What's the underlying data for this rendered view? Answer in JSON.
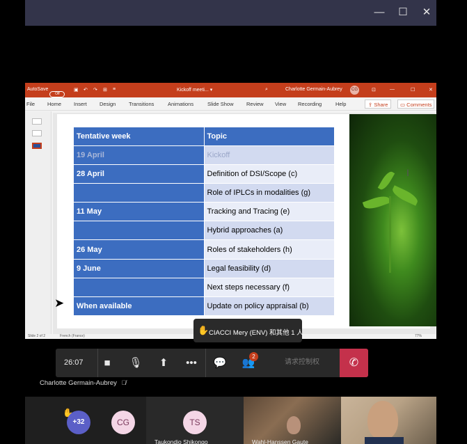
{
  "window_controls": {
    "minimize": "—",
    "maximize": "☐",
    "close": "✕"
  },
  "ppt": {
    "autosave_label": "AutoSave",
    "autosave_state": "Off",
    "doc_title": "Kickoff meeti... ▾",
    "user_name": "Charlotte Germain-Aubrey",
    "user_initials": "CG",
    "menu": [
      "File",
      "Home",
      "Insert",
      "Design",
      "Transitions",
      "Animations",
      "Slide Show",
      "Review",
      "View",
      "Recording",
      "Help"
    ],
    "share_label": "Share",
    "comments_label": "Comments",
    "status_left": "Slide 2 of 2",
    "status_lang": "French (France)",
    "status_zoom": "77%"
  },
  "table": {
    "headers": [
      "Tentative week",
      "Topic"
    ],
    "rows": [
      {
        "week": "19 April",
        "topic": "Kickoff"
      },
      {
        "week": "28 April",
        "topic": "Definition of DSI/Scope (c)"
      },
      {
        "week": "",
        "topic": "Role of IPLCs in modalities (g)"
      },
      {
        "week": "11 May",
        "topic": "Tracking and Tracing (e)"
      },
      {
        "week": "",
        "topic": "Hybrid approaches (a)"
      },
      {
        "week": "26 May",
        "topic": "Roles of stakeholders (h)"
      },
      {
        "week": "9 June",
        "topic": "Legal feasibility (d)"
      },
      {
        "week": "",
        "topic": "Next steps necessary (f)"
      },
      {
        "week": "When available",
        "topic": "Update on policy appraisal (b)"
      }
    ]
  },
  "notification": {
    "text": "CIACCI Mery (ENV) 和其他 1 人"
  },
  "controls": {
    "timer": "26:07",
    "participants_badge": "2",
    "request_control_label": "请求控制权"
  },
  "presenter": {
    "name": "Charlotte Germain-Aubrey"
  },
  "participants": {
    "overflow_count": "+32",
    "tile_cg": "CG",
    "tile_ts": "TS",
    "tile_ts_name": "Taukondjo Shikongo",
    "tile_video1_name": "Wahl-Hanssen Gaute"
  }
}
